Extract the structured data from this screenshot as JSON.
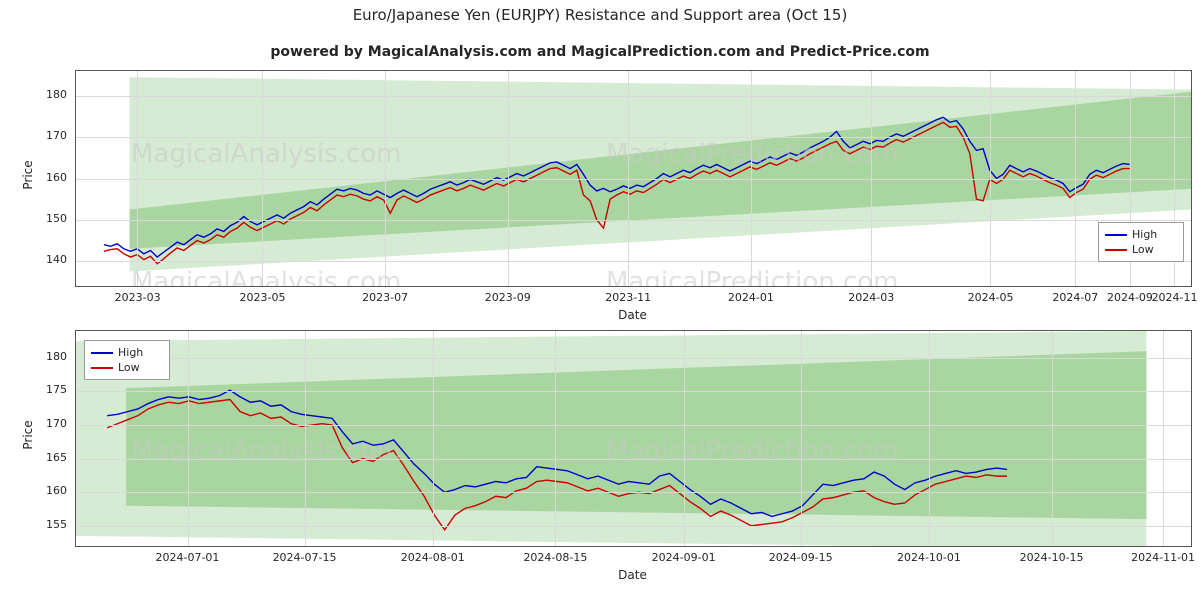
{
  "title": "Euro/Japanese Yen (EURJPY) Resistance and Support area (Oct 15)",
  "subtitle": "powered by MagicalAnalysis.com and MagicalPrediction.com and Predict-Price.com",
  "watermarks": [
    "MagicalAnalysis.com",
    "MagicalPrediction.com",
    "MagicalAnalysis.com",
    "MagicalPrediction.com",
    "MagicalAnalysis.com",
    "MagicalPrediction.com"
  ],
  "colors": {
    "high": "#0000cc",
    "low": "#cc0000",
    "band_outer": "#d6ebd3",
    "band_inner": "#a9d6a0",
    "grid": "#d9d9d9",
    "axis": "#555555"
  },
  "chart_data": [
    {
      "type": "line",
      "id": "upper-chart",
      "title": "Euro/Japanese Yen (EURJPY) Resistance and Support area (Oct 15)",
      "xlabel": "Date",
      "ylabel": "Price",
      "ylim": [
        134,
        186
      ],
      "yticks": [
        140,
        150,
        160,
        170,
        180
      ],
      "xticks": [
        "2023-03",
        "2023-05",
        "2023-07",
        "2023-09",
        "2023-11",
        "2024-01",
        "2024-03",
        "2024-05",
        "2024-07",
        "2024-09",
        "2024-11"
      ],
      "grid": true,
      "legend_position": "right",
      "legend": [
        "High",
        "Low"
      ],
      "series": [
        {
          "name": "High",
          "color": "#0000cc",
          "values": [
            144.0,
            143.6,
            144.2,
            143.0,
            142.4,
            143.0,
            141.8,
            142.6,
            141.0,
            142.2,
            143.4,
            144.6,
            144.0,
            145.2,
            146.4,
            145.8,
            146.6,
            147.8,
            147.2,
            148.6,
            149.4,
            150.8,
            149.6,
            148.8,
            149.6,
            150.4,
            151.2,
            150.4,
            151.6,
            152.4,
            153.2,
            154.4,
            153.6,
            155.0,
            156.2,
            157.4,
            157.0,
            157.6,
            157.2,
            156.4,
            156.0,
            157.0,
            156.2,
            155.4,
            156.4,
            157.2,
            156.4,
            155.6,
            156.4,
            157.4,
            158.0,
            158.6,
            159.2,
            158.4,
            159.0,
            159.8,
            159.2,
            158.6,
            159.4,
            160.2,
            159.6,
            160.4,
            161.2,
            160.6,
            161.4,
            162.2,
            163.0,
            163.8,
            164.0,
            163.2,
            162.4,
            163.4,
            161.0,
            158.4,
            157.0,
            157.6,
            156.8,
            157.4,
            158.2,
            157.6,
            158.4,
            158.0,
            159.0,
            160.0,
            161.2,
            160.4,
            161.2,
            162.0,
            161.4,
            162.4,
            163.2,
            162.6,
            163.4,
            162.6,
            161.8,
            162.6,
            163.4,
            164.2,
            163.6,
            164.4,
            165.2,
            164.6,
            165.4,
            166.2,
            165.6,
            166.4,
            167.4,
            168.2,
            169.0,
            170.0,
            171.4,
            169.0,
            167.4,
            168.2,
            169.0,
            168.4,
            169.2,
            169.0,
            170.0,
            170.8,
            170.2,
            171.0,
            171.8,
            172.6,
            173.4,
            174.2,
            174.8,
            173.6,
            174.0,
            172.0,
            169.0,
            166.8,
            167.2,
            162.0,
            160.0,
            161.0,
            163.2,
            162.4,
            161.6,
            162.4,
            161.8,
            161.0,
            160.2,
            159.6,
            158.8,
            156.8,
            157.8,
            158.6,
            161.0,
            162.0,
            161.4,
            162.2,
            163.0,
            163.6,
            163.4
          ]
        },
        {
          "name": "Low",
          "color": "#cc0000",
          "values": [
            142.4,
            142.8,
            143.0,
            141.8,
            141.0,
            141.6,
            140.4,
            141.2,
            139.4,
            140.6,
            142.0,
            143.2,
            142.6,
            143.8,
            145.0,
            144.4,
            145.2,
            146.4,
            145.8,
            147.2,
            148.0,
            149.4,
            148.2,
            147.4,
            148.2,
            149.0,
            149.8,
            149.0,
            150.2,
            151.0,
            151.8,
            153.0,
            152.2,
            153.6,
            154.8,
            156.0,
            155.6,
            156.2,
            155.8,
            155.0,
            154.6,
            155.6,
            154.8,
            151.6,
            154.8,
            155.8,
            155.0,
            154.2,
            155.0,
            156.0,
            156.6,
            157.2,
            157.8,
            157.0,
            157.6,
            158.4,
            157.8,
            157.2,
            158.0,
            158.8,
            158.2,
            159.0,
            159.8,
            159.2,
            160.0,
            160.8,
            161.6,
            162.4,
            162.6,
            161.8,
            161.0,
            162.0,
            156.0,
            154.6,
            150.0,
            148.0,
            155.0,
            156.0,
            156.8,
            156.2,
            157.0,
            156.6,
            157.6,
            158.6,
            159.8,
            159.0,
            159.8,
            160.6,
            160.0,
            161.0,
            161.8,
            161.2,
            162.0,
            161.2,
            160.4,
            161.2,
            162.0,
            162.8,
            162.2,
            163.0,
            163.8,
            163.2,
            164.0,
            164.8,
            164.2,
            165.0,
            166.0,
            166.8,
            167.6,
            168.4,
            169.0,
            166.8,
            166.0,
            166.8,
            167.6,
            167.0,
            167.8,
            167.6,
            168.6,
            169.4,
            168.8,
            169.6,
            170.4,
            171.2,
            172.0,
            172.8,
            173.6,
            172.4,
            172.6,
            170.0,
            166.0,
            155.0,
            154.6,
            159.8,
            158.8,
            159.8,
            162.0,
            161.2,
            160.4,
            161.2,
            160.6,
            159.8,
            159.0,
            158.4,
            157.6,
            155.4,
            156.6,
            157.4,
            159.8,
            160.8,
            160.2,
            161.0,
            161.8,
            162.4,
            162.4
          ]
        }
      ],
      "bands": [
        {
          "name": "outer-resistance-support",
          "color": "#d6ebd3"
        },
        {
          "name": "inner-resistance-support",
          "color": "#a9d6a0"
        }
      ]
    },
    {
      "type": "line",
      "id": "lower-chart",
      "xlabel": "Date",
      "ylabel": "Price",
      "ylim": [
        152,
        184
      ],
      "yticks": [
        155,
        160,
        165,
        170,
        175,
        180
      ],
      "xticks": [
        "2024-07-01",
        "2024-07-15",
        "2024-08-01",
        "2024-08-15",
        "2024-09-01",
        "2024-09-15",
        "2024-10-01",
        "2024-10-15",
        "2024-11-01"
      ],
      "grid": true,
      "legend_position": "upper left",
      "legend": [
        "High",
        "Low"
      ],
      "series": [
        {
          "name": "High",
          "color": "#0000cc",
          "values": [
            171.4,
            171.6,
            172.0,
            172.4,
            173.2,
            173.8,
            174.2,
            174.0,
            174.2,
            173.8,
            174.0,
            174.4,
            175.2,
            174.2,
            173.4,
            173.6,
            172.8,
            173.0,
            172.0,
            171.6,
            171.4,
            171.2,
            171.0,
            169.0,
            167.2,
            167.6,
            167.0,
            167.2,
            167.8,
            166.0,
            164.2,
            162.8,
            161.2,
            160.0,
            160.4,
            161.0,
            160.8,
            161.2,
            161.6,
            161.4,
            162.0,
            162.2,
            163.8,
            163.6,
            163.4,
            163.2,
            162.6,
            162.0,
            162.4,
            161.8,
            161.2,
            161.6,
            161.4,
            161.2,
            162.4,
            162.8,
            161.6,
            160.4,
            159.4,
            158.2,
            159.0,
            158.4,
            157.6,
            156.8,
            157.0,
            156.4,
            156.8,
            157.2,
            158.0,
            159.6,
            161.2,
            161.0,
            161.4,
            161.8,
            162.0,
            163.0,
            162.4,
            161.2,
            160.4,
            161.4,
            161.8,
            162.4,
            162.8,
            163.2,
            162.8,
            163.0,
            163.4,
            163.6,
            163.4
          ]
        },
        {
          "name": "Low",
          "color": "#cc0000",
          "values": [
            169.6,
            170.2,
            170.8,
            171.4,
            172.4,
            173.0,
            173.4,
            173.2,
            173.6,
            173.2,
            173.4,
            173.6,
            173.8,
            172.0,
            171.4,
            171.8,
            171.0,
            171.2,
            170.2,
            169.8,
            170.0,
            170.2,
            170.0,
            166.6,
            164.4,
            165.0,
            164.6,
            165.6,
            166.2,
            164.0,
            161.6,
            159.4,
            156.6,
            154.4,
            156.6,
            157.6,
            158.0,
            158.6,
            159.4,
            159.2,
            160.2,
            160.6,
            161.6,
            161.8,
            161.6,
            161.4,
            160.8,
            160.2,
            160.6,
            160.0,
            159.4,
            159.8,
            160.0,
            159.8,
            160.4,
            161.0,
            159.8,
            158.6,
            157.6,
            156.4,
            157.2,
            156.6,
            155.8,
            155.0,
            155.2,
            155.4,
            155.6,
            156.2,
            157.0,
            157.8,
            159.0,
            159.2,
            159.6,
            160.0,
            160.2,
            159.2,
            158.6,
            158.2,
            158.4,
            159.6,
            160.4,
            161.2,
            161.6,
            162.0,
            162.4,
            162.2,
            162.6,
            162.4,
            162.4
          ]
        }
      ],
      "bands": [
        {
          "name": "outer-resistance-support",
          "color": "#d6ebd3"
        },
        {
          "name": "inner-resistance-support",
          "color": "#a9d6a0"
        }
      ]
    }
  ]
}
